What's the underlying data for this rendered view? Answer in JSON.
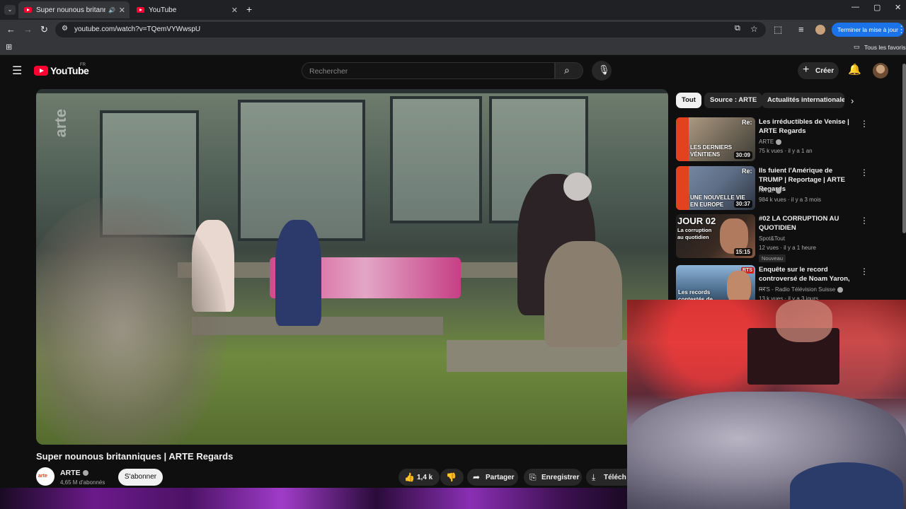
{
  "browser": {
    "tabs": [
      {
        "label": "Super nounous britanniques",
        "active": true,
        "audio": "🔊"
      },
      {
        "label": "YouTube",
        "active": false
      }
    ],
    "new_tab": "+",
    "window_controls": [
      "—",
      "▢",
      "✕"
    ],
    "url": "youtube.com/watch?v=TQemVYWwspU",
    "update_button": "Terminer la mise à jour",
    "bookmarks_all": "Tous les favoris"
  },
  "masthead": {
    "logo_text": "YouTube",
    "region": "FR",
    "search_placeholder": "Rechercher",
    "create_label": "Créer"
  },
  "video": {
    "title": "Super nounous britanniques | ARTE Regards",
    "watermark": "arte"
  },
  "channel": {
    "logo_text": "arte",
    "name": "ARTE",
    "subscribers": "4,65 M d'abonnés",
    "subscribe_label": "S'abonner"
  },
  "actions": {
    "likes": "1,4 k",
    "share": "Partager",
    "save": "Enregistrer",
    "download": "Téléch"
  },
  "sidebar": {
    "chips": [
      "Tout",
      "Source : ARTE",
      "Actualités internationale"
    ],
    "recommendations": [
      {
        "title": "Les irréductibles de Venise | ARTE Regards",
        "channel": "ARTE",
        "verified": true,
        "meta": "75 k vues · il y a 1 an",
        "duration": "30:09",
        "thumb_text": "LES DERNIERS VÉNITIENS",
        "thumb_tag": "Re:"
      },
      {
        "title": "Ils fuient l'Amérique de TRUMP | Reportage | ARTE Regards",
        "channel": "ARTE",
        "verified": true,
        "meta": "984 k vues · il y a 3 mois",
        "duration": "30:37",
        "thumb_text": "UNE NOUVELLE VIE EN EUROPE",
        "thumb_tag": "Re:"
      },
      {
        "title": "#02 LA CORRUPTION AU QUOTIDIEN",
        "channel": "Spot&Tout",
        "verified": false,
        "meta": "12 vues · il y a 1 heure",
        "duration": "15:15",
        "badge": "Nouveau",
        "thumb_text": "JOUR 02",
        "thumb_sub": "La corruption au quotidien"
      },
      {
        "title": "Enquête sur le record controversé de Noam Yaron, ...",
        "channel": "RTS - Radio Télévision Suisse",
        "verified": true,
        "meta": "13 k vues · il y a 3 jours",
        "thumb_text": "Les records contestés de",
        "thumb_tag": "RTS"
      }
    ]
  }
}
